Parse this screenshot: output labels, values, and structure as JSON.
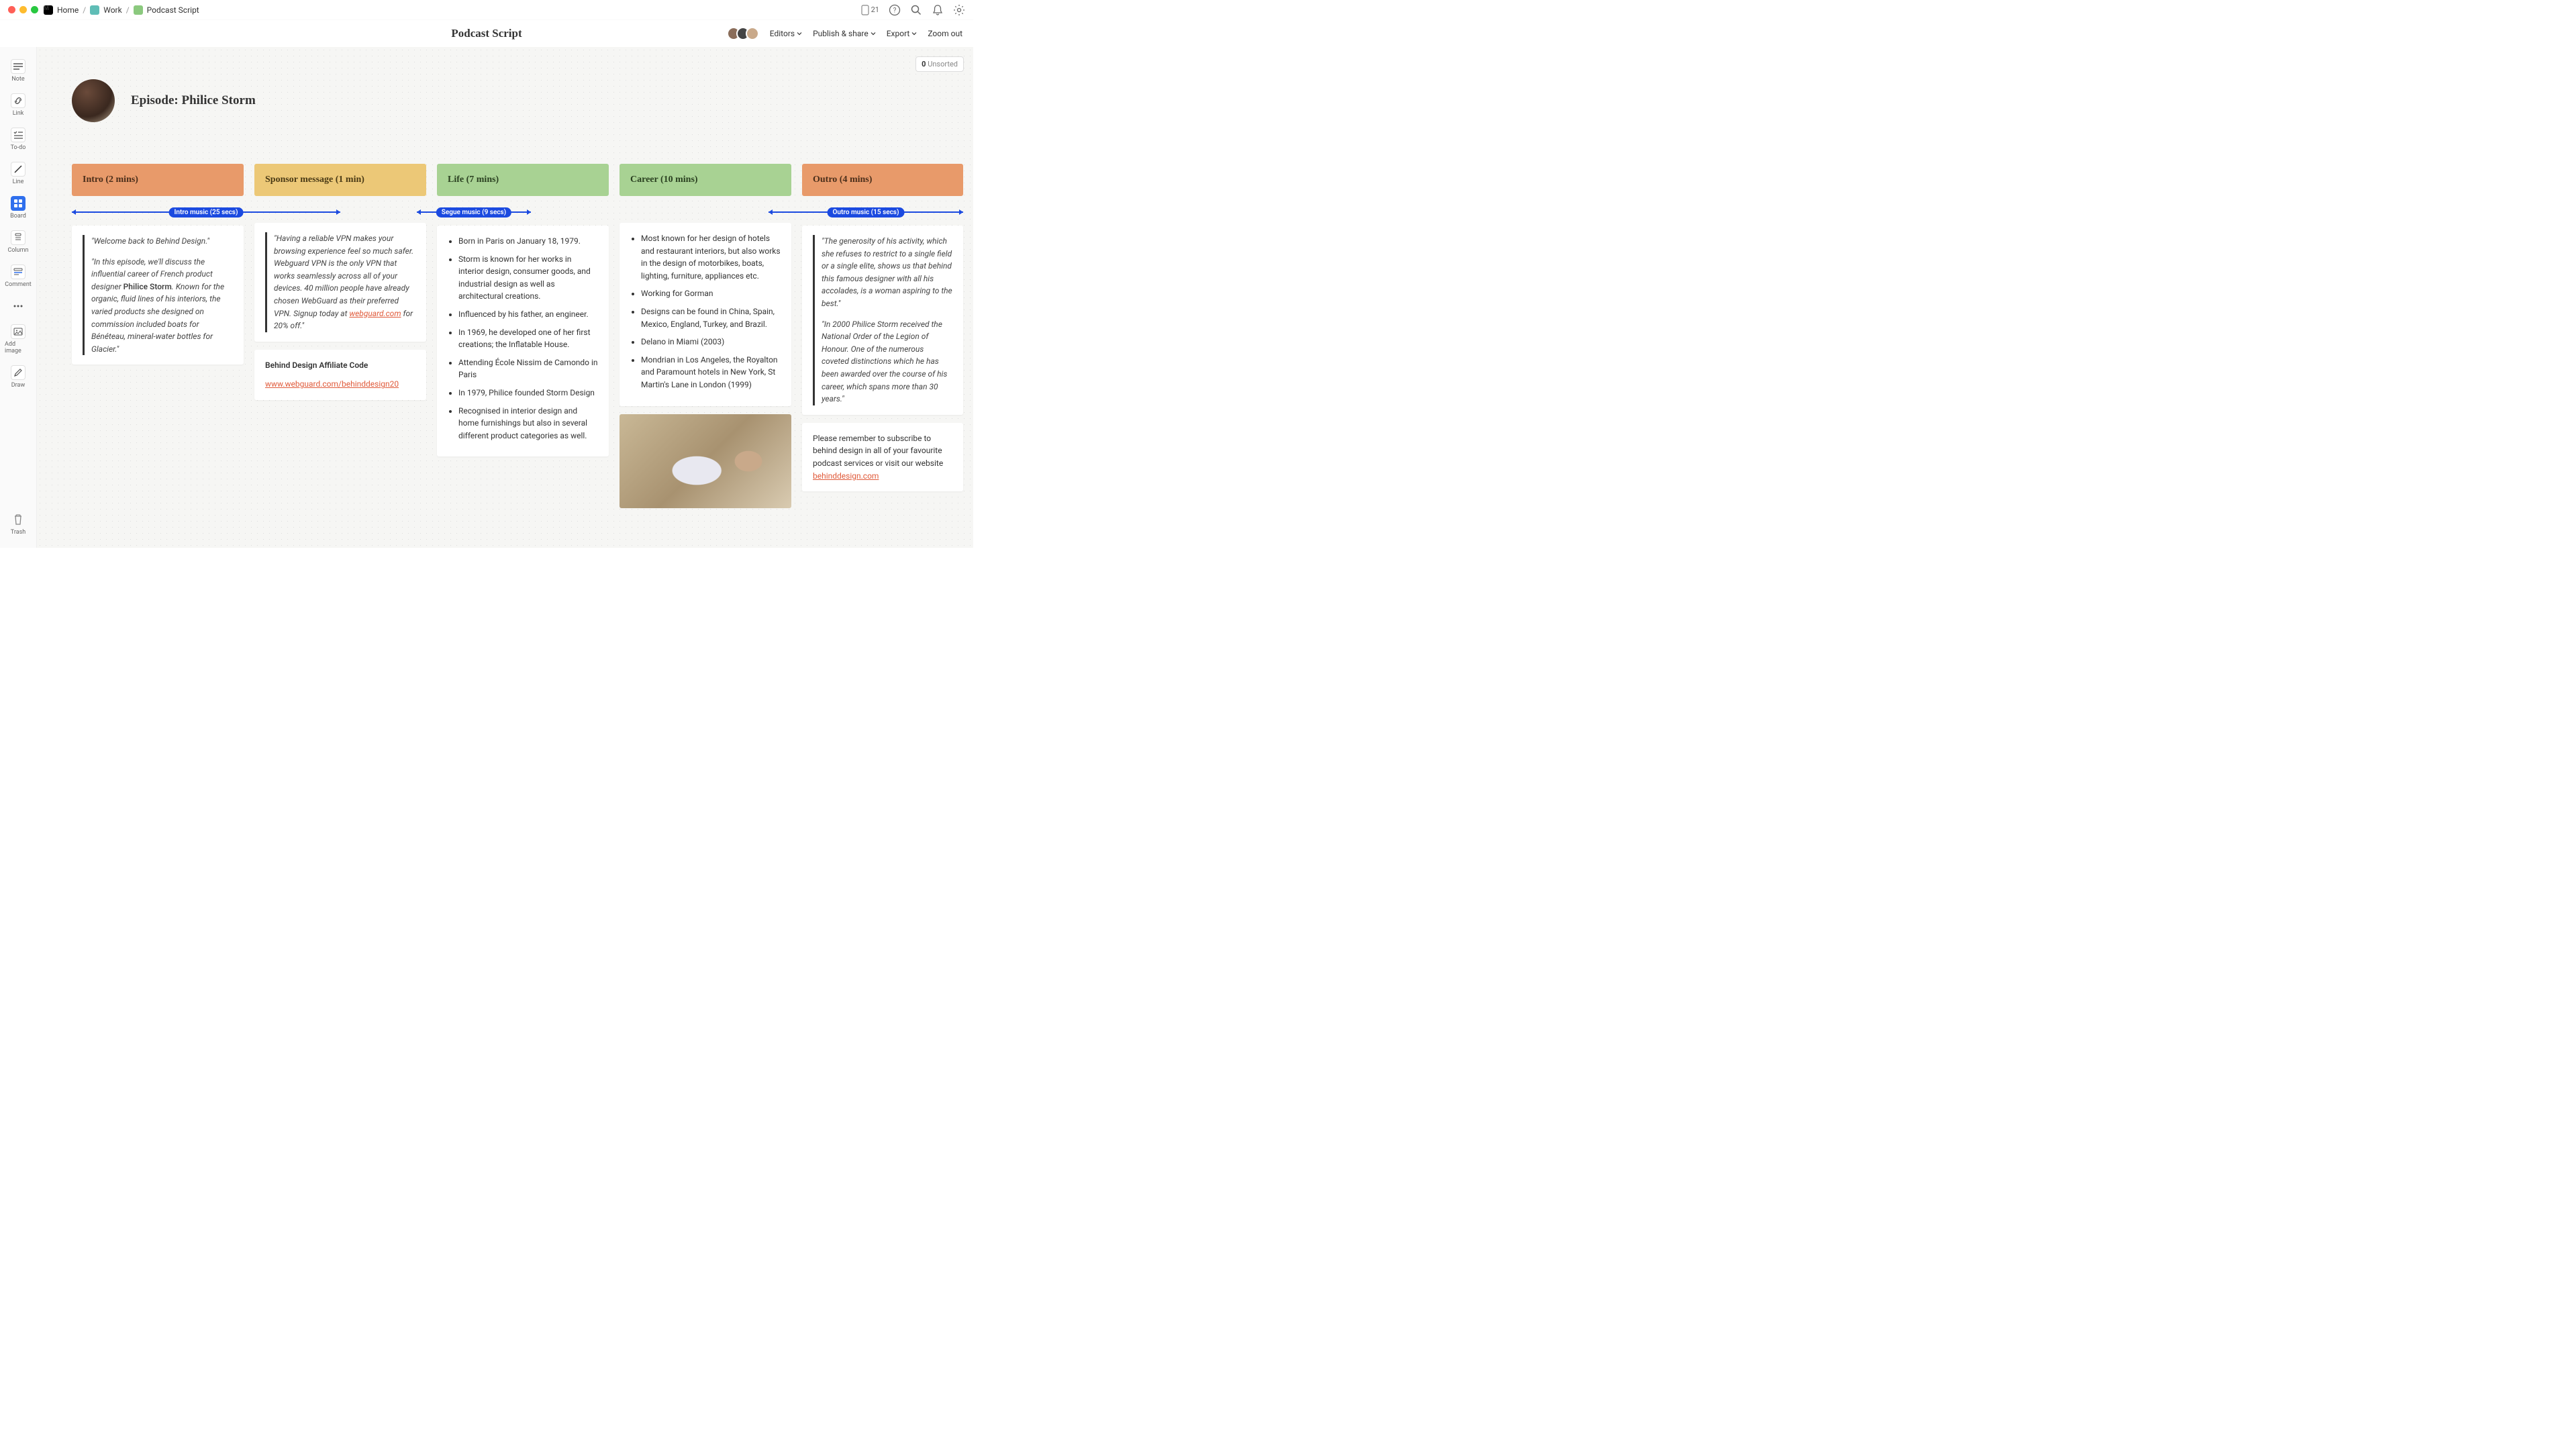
{
  "breadcrumb": {
    "home": "Home",
    "work": "Work",
    "doc": "Podcast Script"
  },
  "notif": "21",
  "title": "Podcast Script",
  "menus": {
    "editors": "Editors",
    "publish": "Publish & share",
    "export": "Export",
    "zoom": "Zoom out"
  },
  "tools": {
    "note": "Note",
    "link": "Link",
    "todo": "To-do",
    "line": "Line",
    "board": "Board",
    "column": "Column",
    "comment": "Comment",
    "addimage": "Add image",
    "draw": "Draw",
    "trash": "Trash"
  },
  "unsorted": {
    "count": "0",
    "label": "Unsorted"
  },
  "episode": {
    "title": "Episode: Philice Storm"
  },
  "cues": {
    "intro": "Intro music (25 secs)",
    "segue": "Segue music (9 secs)",
    "outro": "Outro music (15 secs)"
  },
  "cols": {
    "intro": {
      "header": "Intro (2 mins)",
      "q1": "\"Welcome back to Behind Design.\"",
      "q2a": "\"In this episode, we'll discuss the influential career of French product designer ",
      "q2b": "Philice Storm",
      "q2c": ". Known for the organic, fluid lines of his interiors, the varied products she designed on commission included boats for Bénéteau, mineral-water bottles for Glacier.\""
    },
    "sponsor": {
      "header": "Sponsor message (1 min)",
      "qa": "\"Having a reliable VPN makes your browsing experience feel so much safer. Webguard VPN is the only VPN that works seamlessly across all of your devices. 40 million people have already chosen WebGuard as their preferred VPN. Signup today at ",
      "link": "webguard.com",
      "qb": " for 20% off.\"",
      "aff_title": "Behind Design Affiliate Code",
      "aff_link": "www.webguard.com/behinddesign20"
    },
    "life": {
      "header": "Life (7 mins)",
      "items": [
        "Born in Paris on January 18, 1979.",
        "Storm is known for her works in interior design, consumer goods, and industrial design as well as architectural creations.",
        "Influenced by his father, an engineer.",
        "In 1969, he developed one of her first creations; the Inflatable House.",
        "Attending École Nissim de Camondo in Paris",
        "In 1979, Philice founded Storm Design",
        "Recognised in interior design and home furnishings but also in several different product categories as well."
      ]
    },
    "career": {
      "header": "Career (10 mins)",
      "items": [
        "Most known for her design of hotels and restaurant interiors, but also works in the design of motorbikes, boats, lighting, furniture, appliances etc.",
        "Working for Gorman",
        "Designs can be found in China, Spain, Mexico, England, Turkey, and Brazil.",
        "Delano in Miami (2003)",
        "Mondrian in Los Angeles, the Royalton and Paramount hotels in New York, St Martin's Lane in London (1999)"
      ]
    },
    "outro": {
      "header": "Outro (4 mins)",
      "q1": "\"The generosity of his activity, which she refuses to restrict to a single field or a single elite, shows us that behind this famous designer with all his accolades, is a woman aspiring to the best.\"",
      "q2": "\"In 2000 Philice Storm received the National Order of the Legion of Honour. One of the numerous coveted distinctions which he has been awarded over the course of his career, which spans more than 30 years.\"",
      "subscribe": "Please remember to subscribe to behind design in all of your favourite podcast services or visit our website ",
      "link": "behinddesign.com"
    }
  }
}
